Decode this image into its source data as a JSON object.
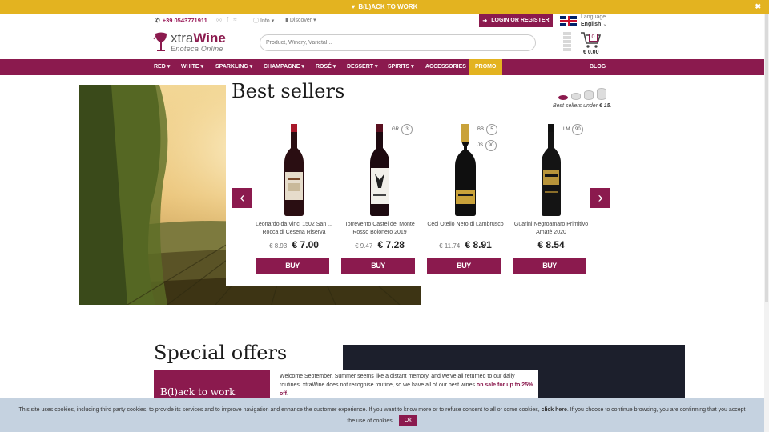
{
  "promo_bar": {
    "icon": "heart-icon",
    "text": "B(L)ACK TO WORK"
  },
  "topbar": {
    "phone": "+39 0543771911",
    "info_label": "Info",
    "discover_label": "Discover",
    "login_label": "LOGIN OR REGISTER",
    "language_label": "Language",
    "language_value": "English"
  },
  "header": {
    "logo_word1": "xtra",
    "logo_word2": "Wine",
    "logo_tagline": "Enoteca Online",
    "search_placeholder": "Product, Winery, Varietal...",
    "cart_count": "0",
    "cart_total": "€ 0.00"
  },
  "nav": {
    "items": [
      "RED ▾",
      "WHITE ▾",
      "SPARKLING ▾",
      "CHAMPAGNE ▾",
      "ROSÉ ▾",
      "DESSERT ▾",
      "SPIRITS ▾",
      "ACCESSORIES",
      "PROMO",
      "BLOG"
    ]
  },
  "best_sellers": {
    "title": "Best sellers",
    "subtitle_prefix": "Best sellers under",
    "subtitle_value": "€ 15",
    "subtitle_suffix": ".",
    "products": [
      {
        "name": "Leonardo da Vinci 1502 San ... Rocca di Cesena Riserva",
        "old_price": "€ 8.93",
        "price": "€ 7.00",
        "buy": "BUY",
        "scores": []
      },
      {
        "name": "Torrevento Castel del Monte Rosso Bolonero 2019",
        "old_price": "€ 9.47",
        "price": "€ 7.28",
        "buy": "BUY",
        "scores": [
          {
            "label": "GR",
            "value": "3"
          }
        ]
      },
      {
        "name": "Ceci Otello Nero di Lambrusco",
        "old_price": "€ 11.74",
        "price": "€ 8.91",
        "buy": "BUY",
        "scores": [
          {
            "label": "BB",
            "value": "5"
          },
          {
            "label": "JS",
            "value": "90"
          }
        ]
      },
      {
        "name": "Guarini Negroamaro Primitivo Amatè 2020",
        "old_price": "",
        "price": "€ 8.54",
        "buy": "BUY",
        "scores": [
          {
            "label": "LM",
            "value": "90"
          }
        ]
      }
    ]
  },
  "special_offers": {
    "title": "Special offers",
    "box_label": "B(l)ack to work",
    "text_main": "Welcome September. Summer seems like a distant memory, and we've all returned to our daily routines. xtraWine does not recognise routine, so we have all of our best wines ",
    "text_bold": "on sale for up to 25% off",
    "text_end": "."
  },
  "cookie": {
    "text_before": "This site uses cookies, including third party cookies, to provide its services and to improve navigation and enhance the customer experience. If you want to know more or to refuse consent to all or some cookies, ",
    "link": "click here",
    "text_after": ". If you choose to continue browsing, you are confirming that you accept the use of cookies.",
    "ok": "Ok"
  },
  "colors": {
    "brand": "#8b1a4e",
    "accent": "#e3b320",
    "cookie_bg": "#c5d2e0"
  }
}
